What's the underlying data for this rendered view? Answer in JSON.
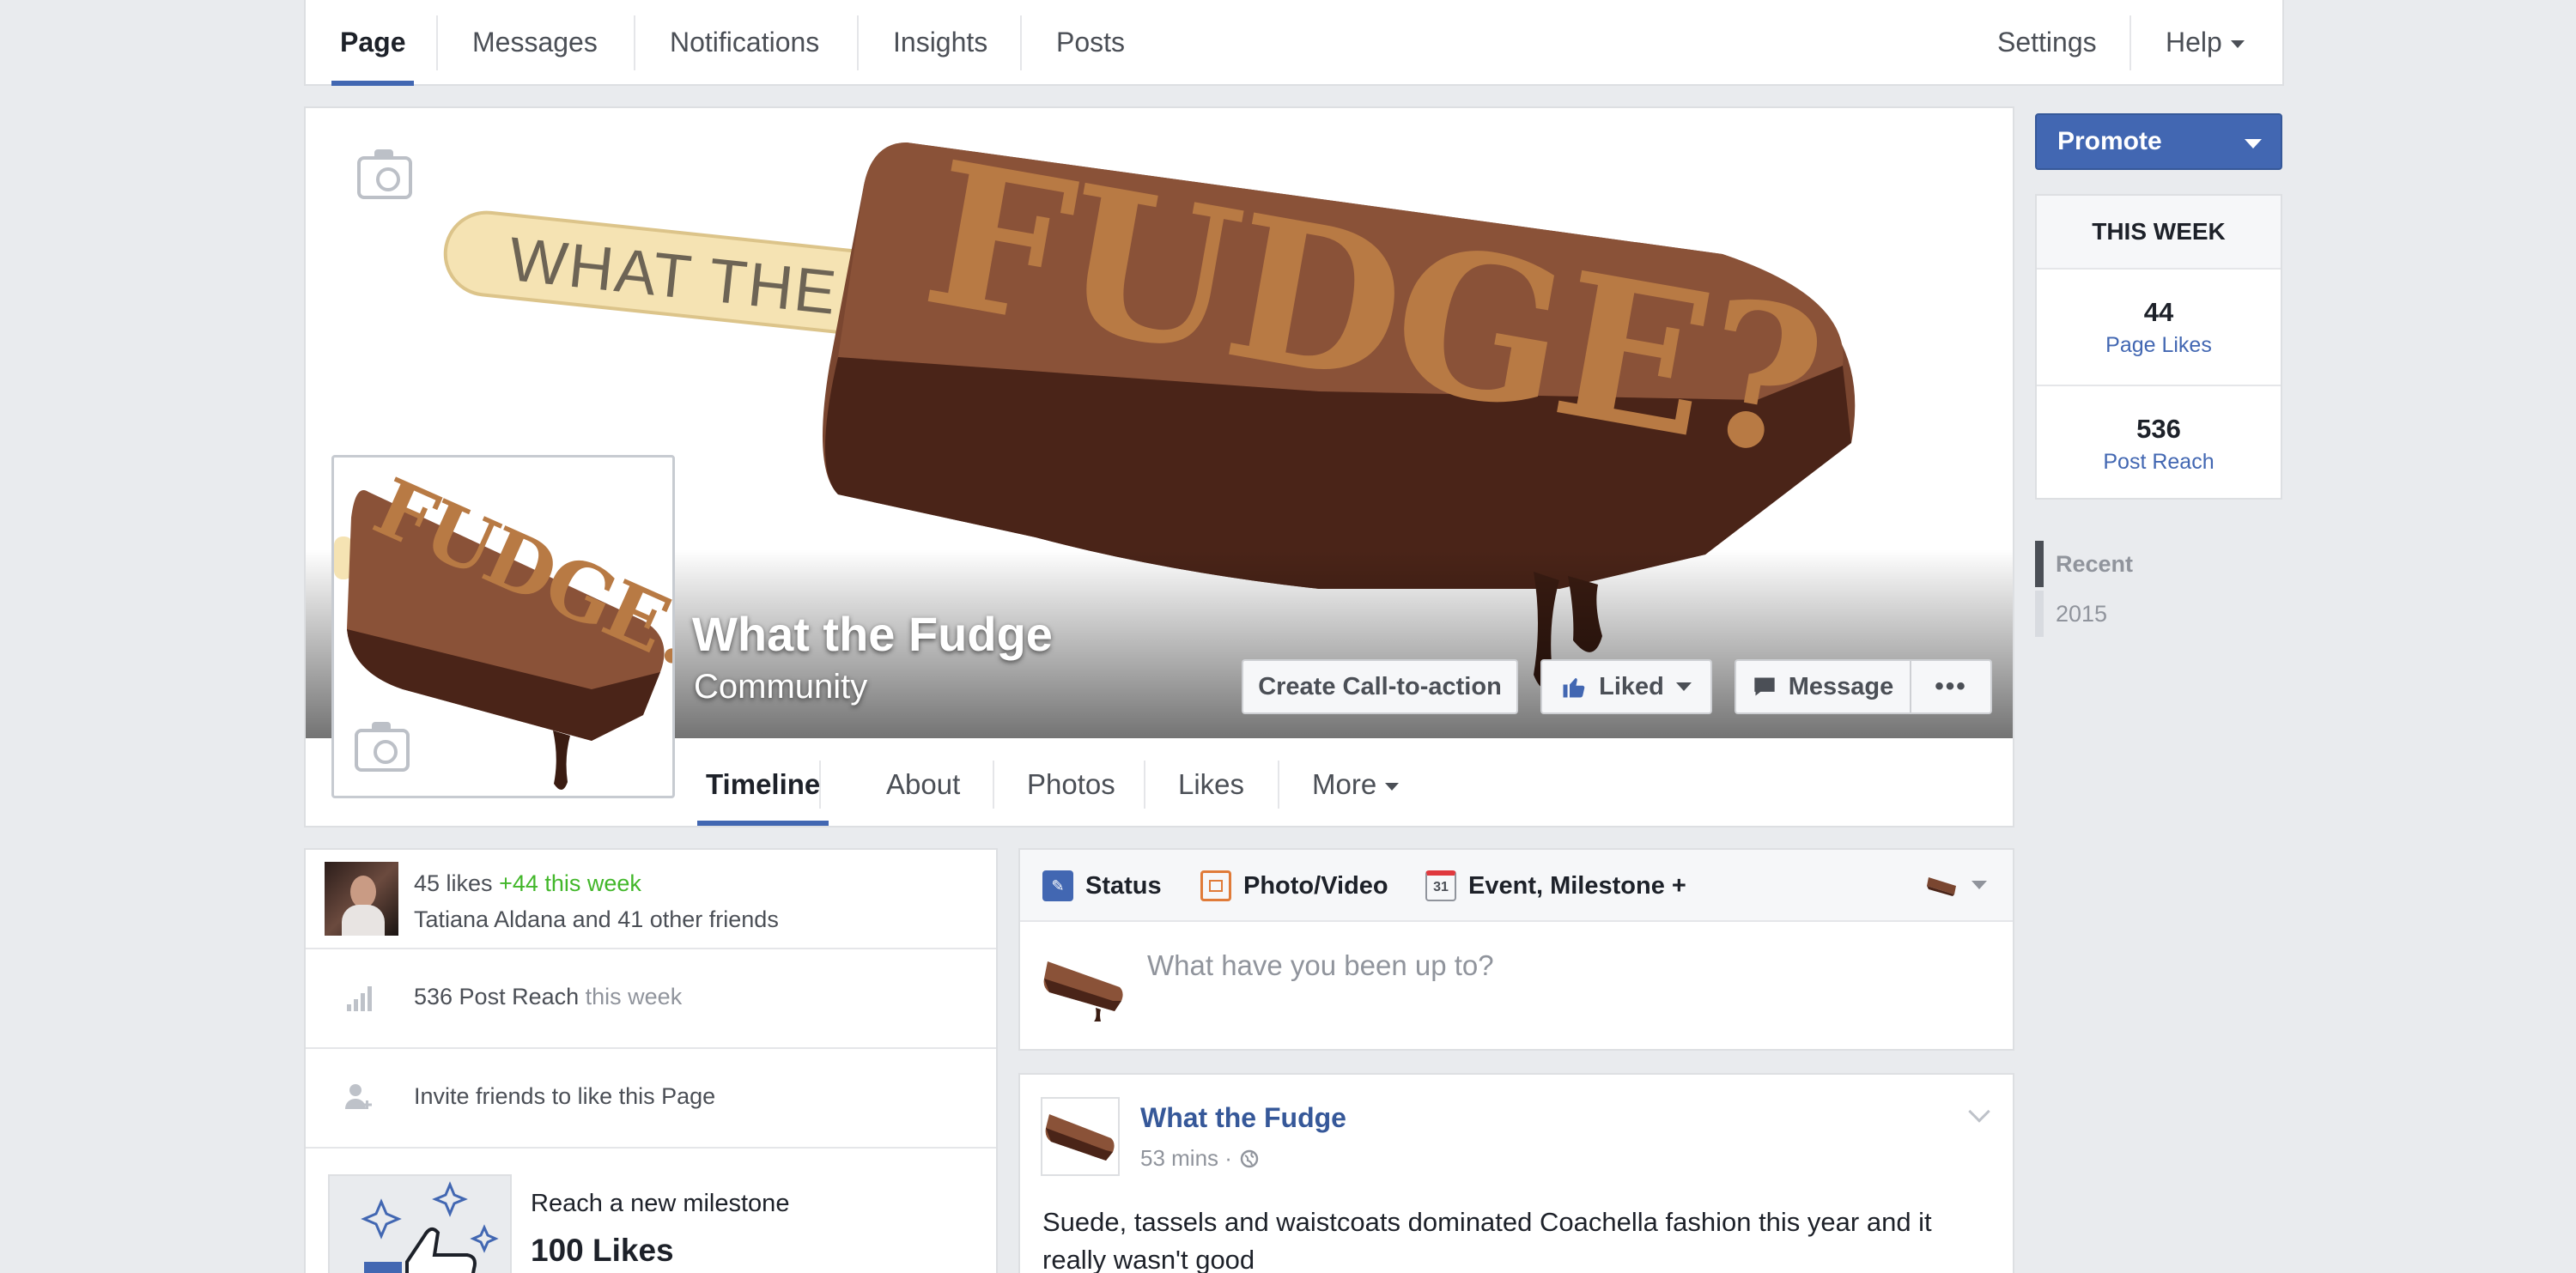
{
  "top_nav": {
    "tabs": [
      "Page",
      "Messages",
      "Notifications",
      "Insights",
      "Posts"
    ],
    "settings": "Settings",
    "help": "Help"
  },
  "cover": {
    "art_text_stick": "WHAT THE",
    "art_text_bar": "FUDGE?",
    "profile_art_text": "FUDGE?"
  },
  "page": {
    "name": "What the Fudge",
    "category": "Community"
  },
  "actions": {
    "cta": "Create Call-to-action",
    "liked": "Liked",
    "message": "Message",
    "more": "•••"
  },
  "sub_tabs": [
    "Timeline",
    "About",
    "Photos",
    "Likes",
    "More"
  ],
  "right_rail": {
    "promote": "Promote",
    "this_week": "THIS WEEK",
    "stats": [
      {
        "value": "44",
        "label": "Page Likes"
      },
      {
        "value": "536",
        "label": "Post Reach"
      }
    ],
    "timeline_nav": [
      "Recent",
      "2015"
    ]
  },
  "left_panel": {
    "likes": "45 likes",
    "likes_week": "+44 this week",
    "friends": "Tatiana Aldana and 41 other friends",
    "reach": "536 Post Reach",
    "reach_week": "this week",
    "invite": "Invite friends to like this Page",
    "milestone_title": "Reach a new milestone",
    "milestone_value": "100 Likes"
  },
  "composer": {
    "tabs": [
      "Status",
      "Photo/Video",
      "Event, Milestone +"
    ],
    "calendar_day": "31",
    "placeholder": "What have you been up to?"
  },
  "post": {
    "author": "What the Fudge",
    "time": "53 mins ·",
    "text": "Suede, tassels and waistcoats dominated Coachella fashion this year and it really wasn't good"
  },
  "colors": {
    "accent": "#4267b2",
    "background": "#e9ebee",
    "chocolate": "#6e3a26",
    "caramel": "#b87a44",
    "positive": "#42b72a"
  }
}
